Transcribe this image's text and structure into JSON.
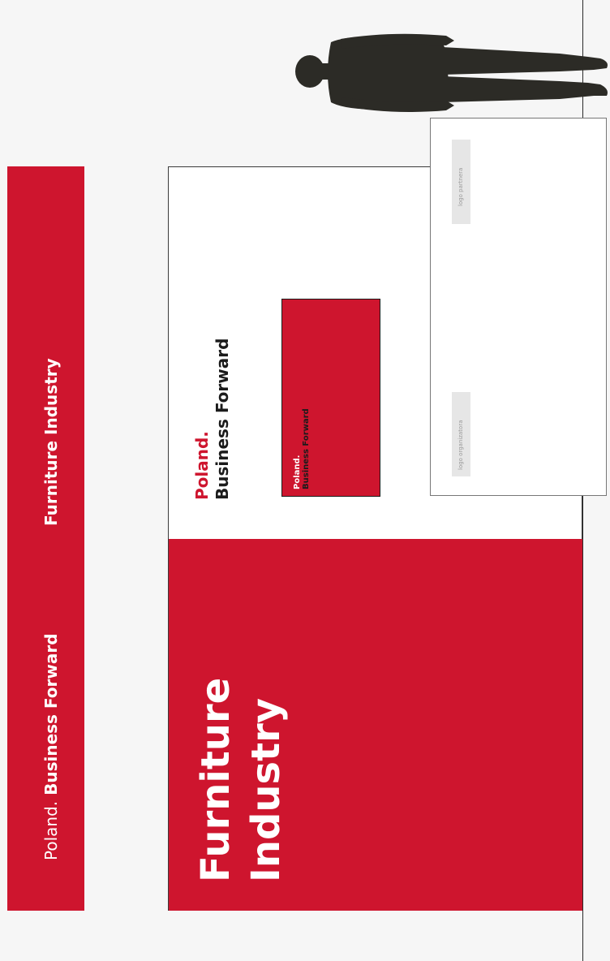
{
  "left_banner": {
    "brand_prefix": "Poland.",
    "brand_suffix": "Business Forward",
    "industry": "Furniture Industry"
  },
  "main_panel": {
    "brand_top": "Poland.",
    "brand_bottom": "Business Forward",
    "title_line1": "Furniture",
    "title_line2": "Industry",
    "mini_card": {
      "brand_top": "Poland.",
      "brand_bottom": "Business Forward"
    }
  },
  "right_board": {
    "partner_logo_label": "logo partnera",
    "organizer_logo_label": "logo organizatora"
  },
  "colors": {
    "brand_red": "#ce152e",
    "panel_white": "#ffffff",
    "background": "#f6f6f6",
    "text_dark": "#1b1b1b",
    "silhouette": "#2c2b26"
  },
  "icons": {
    "scale_figure": "person-silhouette-icon"
  }
}
